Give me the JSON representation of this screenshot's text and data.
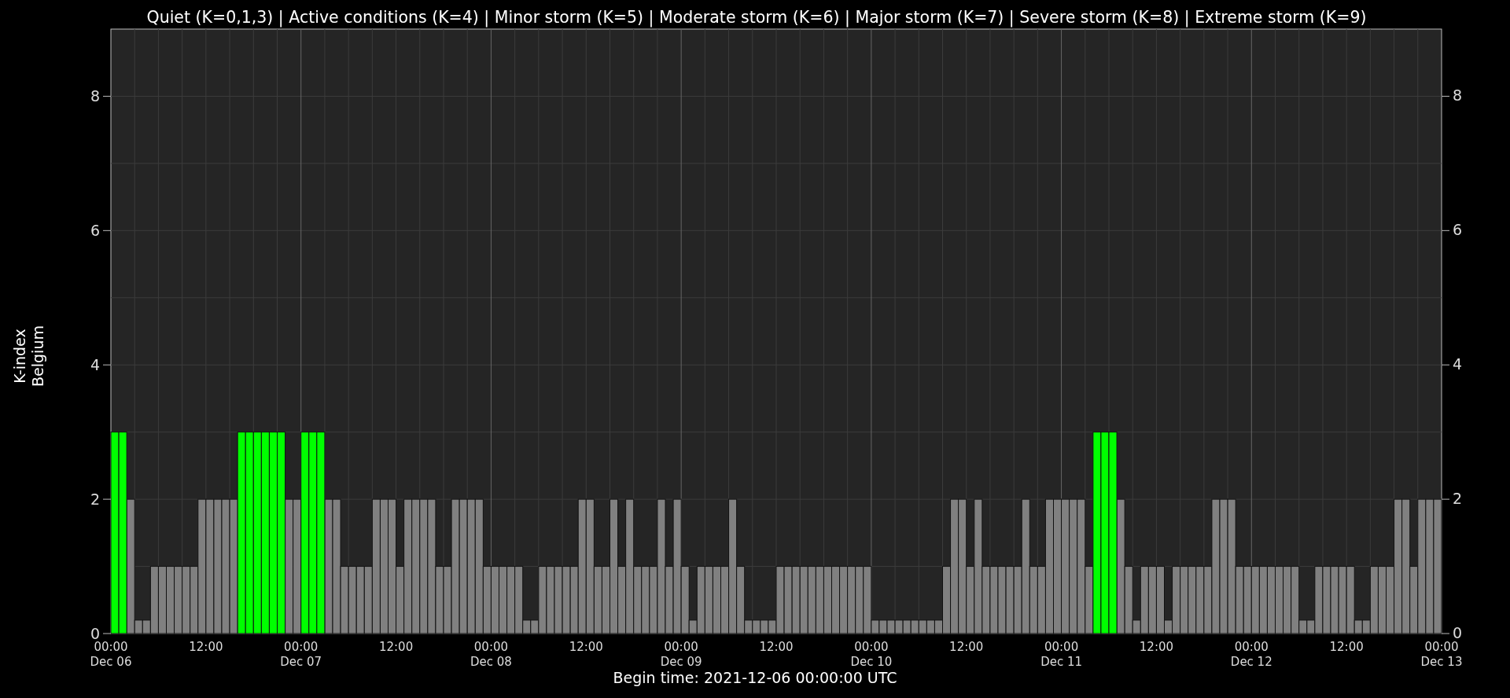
{
  "right_axis": {
    "tick_labels": [
      "8",
      "6",
      "4",
      "2",
      "0"
    ]
  },
  "time_axis": {
    "labels": [
      "00:00\nDec 06",
      "12:00",
      "00:00\nDec 07",
      "12:00",
      "00:00\nDec 08",
      "12:00",
      "00:00\nDec 09",
      "12:00",
      "00:00\nDec 10",
      "12:00",
      "00:00\nDec 11",
      "12:00",
      "00:00\nDec 12",
      "12:00",
      "00:00\nDec 13"
    ]
  },
  "chart_data": {
    "type": "bar",
    "title": "Quiet (K=0,1,3) | Active conditions (K=4) | Minor storm (K=5) | Moderate storm (K=6) | Major storm (K=7) | Severe storm (K=8) | Extreme storm (K=9)",
    "xlabel": "Begin time: 2021-12-06 00:00:00 UTC",
    "ylabel": "K-index\nBelgium",
    "ylim": [
      0,
      9
    ],
    "grid": true,
    "yticks": [
      0,
      2,
      4,
      6,
      8
    ],
    "series": [
      {
        "color": "#808080",
        "values": [
          null,
          null,
          2,
          0.2,
          0.2,
          1,
          1,
          1,
          1,
          1,
          1,
          2,
          2,
          2,
          2,
          2,
          null,
          null,
          null,
          null,
          null,
          null,
          2,
          2,
          null,
          null,
          null,
          2,
          2,
          1,
          1,
          1,
          1,
          2,
          2,
          2,
          1,
          2,
          2,
          2,
          2,
          1,
          1,
          2,
          2,
          2,
          2,
          1,
          1,
          1,
          1,
          1,
          0.2,
          0.2,
          1,
          1,
          1,
          1,
          1,
          2,
          2,
          1,
          1,
          2,
          1,
          2,
          1,
          1,
          1,
          2,
          1,
          2,
          1,
          0.2,
          1,
          1,
          1,
          1,
          2,
          1,
          0.2,
          0.2,
          0.2,
          0.2,
          1,
          1,
          1,
          1,
          1,
          1,
          1,
          1,
          1,
          1,
          1,
          1,
          0.2,
          0.2,
          0.2,
          0.2,
          0.2,
          0.2,
          0.2,
          0.2,
          0.2,
          1,
          2,
          2,
          1,
          2,
          1,
          1,
          1,
          1,
          1,
          2,
          1,
          1,
          2,
          2,
          2,
          2,
          2,
          1,
          null,
          null,
          null,
          2,
          1,
          0.2,
          1,
          1,
          1,
          0.2,
          1,
          1,
          1,
          1,
          1,
          2,
          2,
          2,
          1,
          1,
          1,
          1,
          1,
          1,
          1,
          1,
          0.2,
          0.2,
          1,
          1,
          1,
          1,
          1,
          0.2,
          0.2,
          1,
          1,
          1,
          2,
          2,
          1,
          2,
          2,
          2
        ]
      },
      {
        "color": "#00ff00",
        "values": [
          3,
          3,
          null,
          null,
          null,
          null,
          null,
          null,
          null,
          null,
          null,
          null,
          null,
          null,
          null,
          null,
          3,
          3,
          3,
          3,
          3,
          3,
          null,
          null,
          3,
          3,
          3,
          null,
          null,
          null,
          null,
          null,
          null,
          null,
          null,
          null,
          null,
          null,
          null,
          null,
          null,
          null,
          null,
          null,
          null,
          null,
          null,
          null,
          null,
          null,
          null,
          null,
          null,
          null,
          null,
          null,
          null,
          null,
          null,
          null,
          null,
          null,
          null,
          null,
          null,
          null,
          null,
          null,
          null,
          null,
          null,
          null,
          null,
          null,
          null,
          null,
          null,
          null,
          null,
          null,
          null,
          null,
          null,
          null,
          null,
          null,
          null,
          null,
          null,
          null,
          null,
          null,
          null,
          null,
          null,
          null,
          null,
          null,
          null,
          null,
          null,
          null,
          null,
          null,
          null,
          null,
          null,
          null,
          null,
          null,
          null,
          null,
          null,
          null,
          null,
          null,
          null,
          null,
          null,
          null,
          null,
          null,
          null,
          null,
          3,
          3,
          3,
          null,
          null,
          null,
          null,
          null,
          null,
          null,
          null,
          null,
          null,
          null,
          null,
          null,
          null,
          null,
          null,
          null,
          null,
          null,
          null,
          null,
          null,
          null,
          null,
          null,
          null,
          null,
          null,
          null,
          null,
          null,
          null,
          null,
          null,
          null,
          null,
          null,
          null,
          null,
          null,
          null
        ]
      }
    ]
  }
}
